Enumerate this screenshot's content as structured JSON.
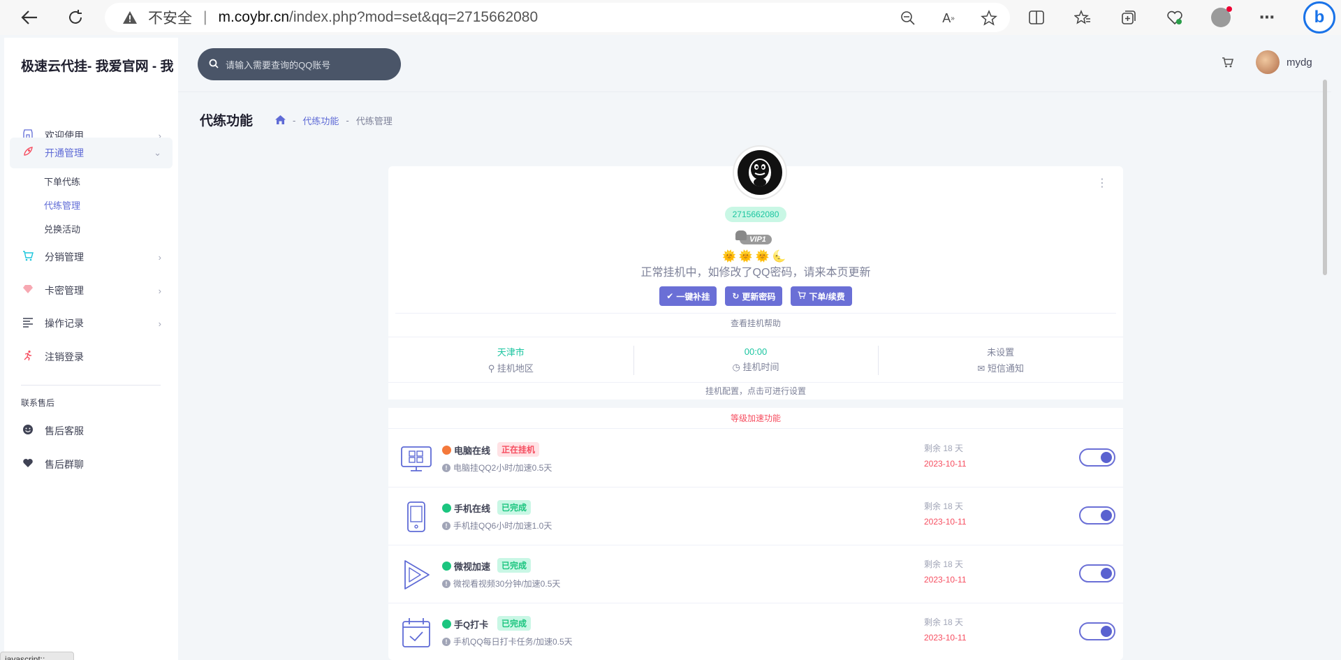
{
  "browser": {
    "insecure_label": "不安全",
    "url_host": "m.coybr.cn",
    "url_path": "/index.php?mod=set&qq=2715662080"
  },
  "sidebar": {
    "brand": "极速云代挂- 我爱官网 - 我",
    "items": [
      {
        "label": "欢迎使用",
        "icon": "store-icon"
      },
      {
        "label": "开通管理",
        "icon": "rocket-icon"
      },
      {
        "label": "分销管理",
        "icon": "cart-icon"
      },
      {
        "label": "卡密管理",
        "icon": "gem-icon"
      },
      {
        "label": "操作记录",
        "icon": "list-icon"
      },
      {
        "label": "注销登录",
        "icon": "run-icon"
      }
    ],
    "sub_items": [
      "下单代练",
      "代练管理",
      "兑换活动"
    ],
    "section_label": "联系售后",
    "after_sales": [
      {
        "label": "售后客服",
        "icon": "smile-icon"
      },
      {
        "label": "售后群聊",
        "icon": "heart-icon"
      }
    ]
  },
  "topbar": {
    "search_placeholder": "请输入需要查询的QQ账号",
    "username": "mydg"
  },
  "page": {
    "title": "代练功能",
    "breadcrumb": [
      "代练功能",
      "代练管理"
    ]
  },
  "card": {
    "qq": "2715662080",
    "vip_label": "VIP1",
    "status_message": "正常挂机中，如修改了QQ密码，请来本页更新",
    "buttons": [
      "一键补挂",
      "更新密码",
      "下单/续费"
    ],
    "help_link": "查看挂机帮助",
    "config": [
      {
        "value": "天津市",
        "label": "挂机地区",
        "color": "#1bc5a0"
      },
      {
        "value": "00:00",
        "label": "挂机时间",
        "color": "#1bc5a0"
      },
      {
        "value": "未设置",
        "label": "短信通知",
        "color": "#7e8299"
      }
    ],
    "config_note": "挂机配置，点击可进行设置",
    "accel_title": "等级加速功能",
    "features": [
      {
        "name": "电脑在线",
        "tag": "正在挂机",
        "tag_type": "running",
        "desc": "电脑挂QQ2小时/加速0.5天",
        "remain": "剩余 18 天",
        "date": "2023-10-11",
        "dot": "#f4793b",
        "enabled": true
      },
      {
        "name": "手机在线",
        "tag": "已完成",
        "tag_type": "done",
        "desc": "手机挂QQ6小时/加速1.0天",
        "remain": "剩余 18 天",
        "date": "2023-10-11",
        "dot": "#1bc57f",
        "enabled": true
      },
      {
        "name": "微视加速",
        "tag": "已完成",
        "tag_type": "done",
        "desc": "微视看视频30分钟/加速0.5天",
        "remain": "剩余 18 天",
        "date": "2023-10-11",
        "dot": "#1bc57f",
        "enabled": true
      },
      {
        "name": "手Q打卡",
        "tag": "已完成",
        "tag_type": "done",
        "desc": "手机QQ每日打卡任务/加速0.5天",
        "remain": "剩余 18 天",
        "date": "2023-10-11",
        "dot": "#1bc57f",
        "enabled": true
      }
    ]
  },
  "status_bar_text": "javascript:;"
}
